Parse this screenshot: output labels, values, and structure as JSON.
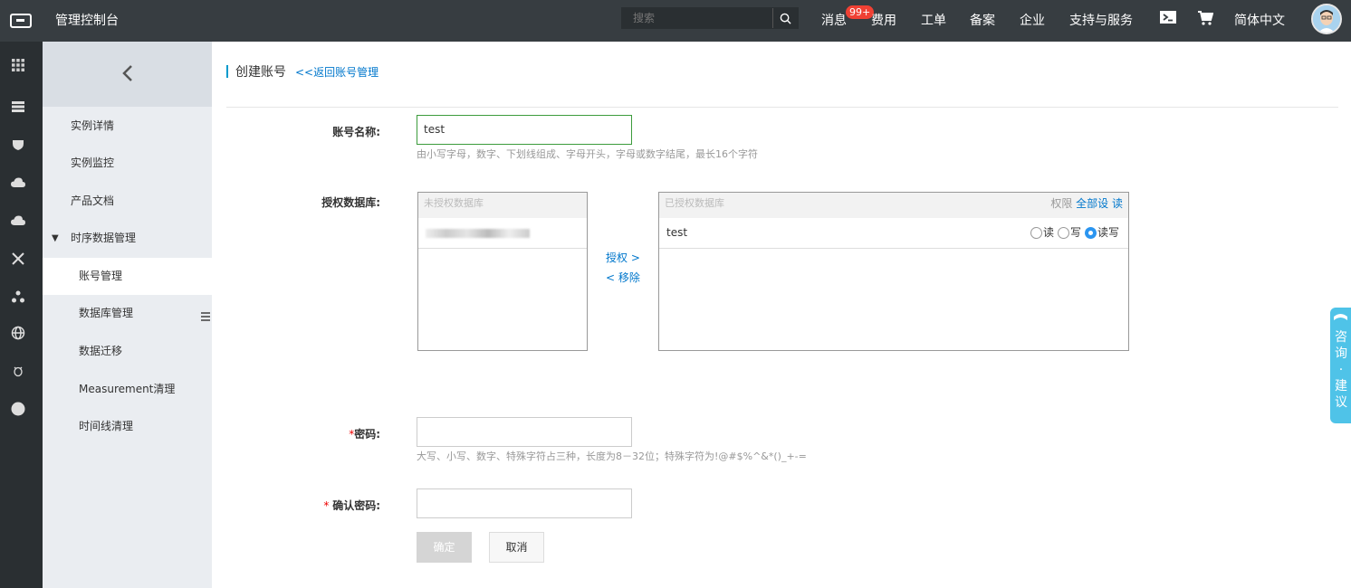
{
  "topbar": {
    "app_title": "管理控制台",
    "search_placeholder": "搜索",
    "nav": {
      "messages": "消息",
      "messages_badge": "99+",
      "billing": "费用",
      "tickets": "工单",
      "icp": "备案",
      "enterprise": "企业",
      "support": "支持与服务",
      "language": "简体中文"
    }
  },
  "sidebar": {
    "items": [
      "实例详情",
      "实例监控",
      "产品文档"
    ],
    "group": "时序数据管理",
    "sub_items": [
      "账号管理",
      "数据库管理",
      "数据迁移",
      "Measurement清理",
      "时间线清理"
    ],
    "active_sub": "账号管理"
  },
  "page": {
    "title": "创建账号",
    "back_link": "<<返回账号管理"
  },
  "form": {
    "account_label": "账号名称:",
    "account_value": "test",
    "account_hint": "由小写字母，数字、下划线组成、字母开头，字母或数字结尾，最长16个字符",
    "db_label": "授权数据库:",
    "unauth_header": "未授权数据库",
    "auth_header": "已授权数据库",
    "perm_label": "权限",
    "perm_all": "全部设 读",
    "authorize_btn": "授权 >",
    "remove_btn": "< 移除",
    "auth_db_name": "test",
    "radio_read": "读",
    "radio_write": "写",
    "radio_readwrite": "读写",
    "radio_selected": "读写",
    "password_required": "*",
    "password_label": "密码:",
    "password_hint": "大写、小写、数字、特殊字符占三种，长度为8－32位；特殊字符为!@#$%^&*()_+-=",
    "confirm_required": "* ",
    "confirm_label": "确认密码:",
    "ok_button": "确定",
    "cancel_button": "取消"
  },
  "consult": {
    "text": "咨询·建议"
  }
}
